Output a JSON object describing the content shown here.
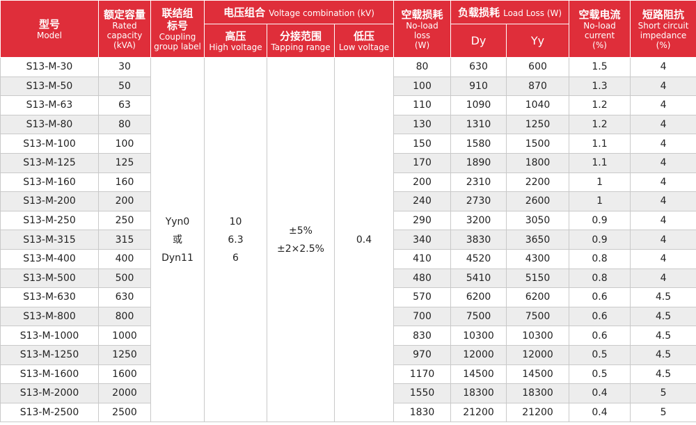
{
  "header": {
    "model": {
      "zh": "型号",
      "en": "Model"
    },
    "capacity": {
      "zh": "额定容量",
      "en1": "Rated",
      "en2": "capacity",
      "en3": "(kVA)"
    },
    "coupling": {
      "zh1": "联结组",
      "zh2": "标号",
      "en1": "Coupling",
      "en2": "group label"
    },
    "voltage": {
      "zh": "电压组合",
      "en": "Voltage combination (kV)"
    },
    "hv": {
      "zh": "高压",
      "en": "High voltage"
    },
    "tap": {
      "zh": "分接范围",
      "en": "Tapping range"
    },
    "lv": {
      "zh": "低压",
      "en": "Low voltage"
    },
    "noload_loss": {
      "zh": "空载损耗",
      "en1": "No-load",
      "en2": "loss",
      "en3": "(W)"
    },
    "load_loss": {
      "zh": "负载损耗",
      "en": "Load Loss (W)"
    },
    "dy": "Dy",
    "yy": "Yy",
    "noload_current": {
      "zh": "空载电流",
      "en1": "No-load",
      "en2": "current",
      "en3": "(%)"
    },
    "impedance": {
      "zh": "短路阻抗",
      "en1": "Short circuit",
      "en2": "impedance",
      "en3": "(%)"
    }
  },
  "merged": {
    "coupling": [
      "Yyn0",
      "或",
      "Dyn11"
    ],
    "hv": [
      "10",
      "6.3",
      "6"
    ],
    "tap": [
      "±5%",
      "±2×2.5%"
    ],
    "lv": "0.4"
  },
  "rows": [
    [
      "S13-M-30",
      "30",
      "80",
      "630",
      "600",
      "1.5",
      "4"
    ],
    [
      "S13-M-50",
      "50",
      "100",
      "910",
      "870",
      "1.3",
      "4"
    ],
    [
      "S13-M-63",
      "63",
      "110",
      "1090",
      "1040",
      "1.2",
      "4"
    ],
    [
      "S13-M-80",
      "80",
      "130",
      "1310",
      "1250",
      "1.2",
      "4"
    ],
    [
      "S13-M-100",
      "100",
      "150",
      "1580",
      "1500",
      "1.1",
      "4"
    ],
    [
      "S13-M-125",
      "125",
      "170",
      "1890",
      "1800",
      "1.1",
      "4"
    ],
    [
      "S13-M-160",
      "160",
      "200",
      "2310",
      "2200",
      "1",
      "4"
    ],
    [
      "S13-M-200",
      "200",
      "240",
      "2730",
      "2600",
      "1",
      "4"
    ],
    [
      "S13-M-250",
      "250",
      "290",
      "3200",
      "3050",
      "0.9",
      "4"
    ],
    [
      "S13-M-315",
      "315",
      "340",
      "3830",
      "3650",
      "0.9",
      "4"
    ],
    [
      "S13-M-400",
      "400",
      "410",
      "4520",
      "4300",
      "0.8",
      "4"
    ],
    [
      "S13-M-500",
      "500",
      "480",
      "5410",
      "5150",
      "0.8",
      "4"
    ],
    [
      "S13-M-630",
      "630",
      "570",
      "6200",
      "6200",
      "0.6",
      "4.5"
    ],
    [
      "S13-M-800",
      "800",
      "700",
      "7500",
      "7500",
      "0.6",
      "4.5"
    ],
    [
      "S13-M-1000",
      "1000",
      "830",
      "10300",
      "10300",
      "0.6",
      "4.5"
    ],
    [
      "S13-M-1250",
      "1250",
      "970",
      "12000",
      "12000",
      "0.5",
      "4.5"
    ],
    [
      "S13-M-1600",
      "1600",
      "1170",
      "14500",
      "14500",
      "0.5",
      "4.5"
    ],
    [
      "S13-M-2000",
      "2000",
      "1550",
      "18300",
      "18300",
      "0.4",
      "5"
    ],
    [
      "S13-M-2500",
      "2500",
      "1830",
      "21200",
      "21200",
      "0.4",
      "5"
    ]
  ]
}
